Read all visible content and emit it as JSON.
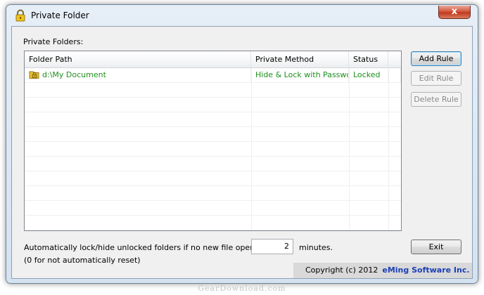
{
  "window": {
    "title": "Private Folder",
    "close_label": "x"
  },
  "group_label": "Private Folders:",
  "table": {
    "columns": [
      "Folder Path",
      "Private Method",
      "Status",
      ""
    ],
    "rows": [
      {
        "path": "d:\\My Document",
        "method": "Hide & Lock with Password",
        "status": "Locked"
      }
    ],
    "row_color": "#1f8f1f"
  },
  "buttons": {
    "add_rule": "Add Rule",
    "edit_rule": "Edit Rule",
    "delete_rule": "Delete Rule",
    "exit": "Exit"
  },
  "auto_lock": {
    "text": "Automatically lock/hide unlocked folders if no new file openned for",
    "value": "2",
    "unit": "minutes.",
    "note": "(0 for not automatically reset)"
  },
  "copyright": {
    "text": "Copyright (c) 2012",
    "company": "eMing Software Inc.",
    "company_color": "#1a3fb6"
  },
  "watermark": "GearDownload.com"
}
